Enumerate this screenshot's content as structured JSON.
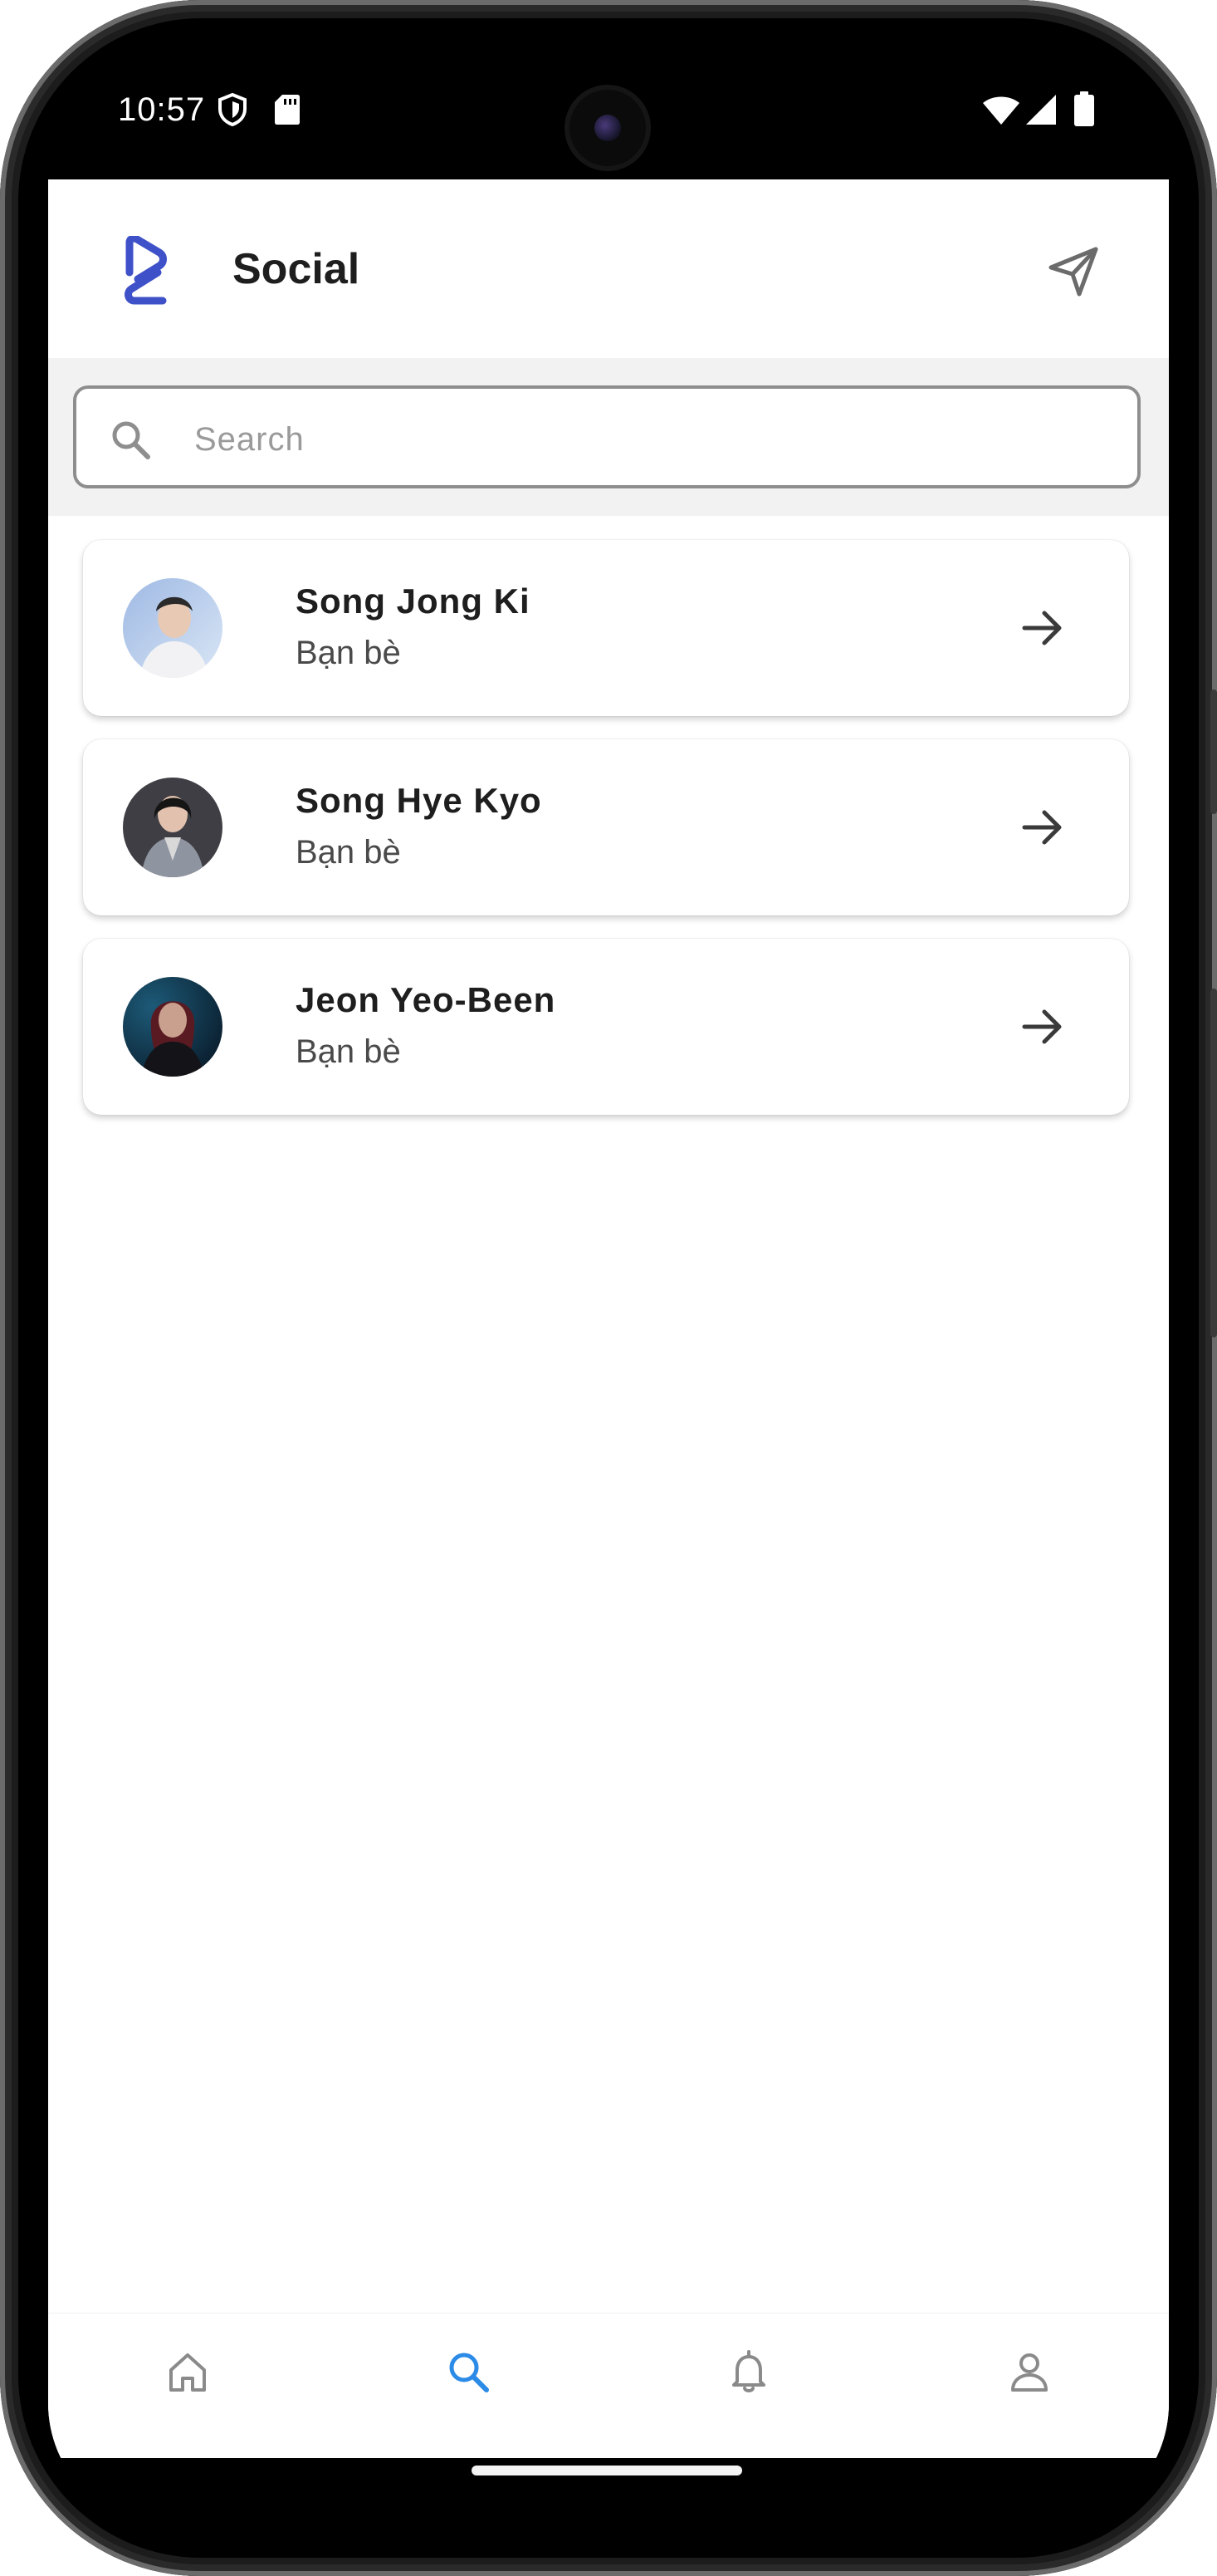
{
  "status_bar": {
    "time": "10:57",
    "icons": [
      "shield-icon",
      "sd-card-icon",
      "wifi-icon",
      "signal-icon",
      "battery-icon"
    ]
  },
  "header": {
    "title": "Social",
    "logo_icon": "app-logo-icon",
    "action_icon": "send-icon"
  },
  "search": {
    "placeholder": "Search",
    "value": ""
  },
  "friends": [
    {
      "name": "Song Jong Ki",
      "relation": "Bạn bè"
    },
    {
      "name": "Song Hye Kyo",
      "relation": "Bạn bè"
    },
    {
      "name": "Jeon Yeo-Been",
      "relation": "Bạn bè"
    }
  ],
  "bottom_nav": {
    "items": [
      "home-icon",
      "search-icon",
      "bell-icon",
      "profile-icon"
    ],
    "active": "search-icon"
  },
  "colors": {
    "accent": "#2b8be6",
    "logo": "#3f51c8",
    "icon_gray": "#8a8a8a",
    "text_dark": "#1e1e1e"
  }
}
